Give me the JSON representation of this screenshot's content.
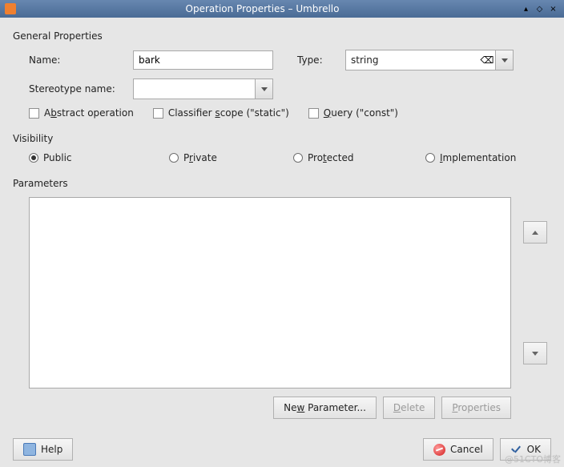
{
  "window": {
    "title": "Operation Properties – Umbrello",
    "shade_icon": "▴",
    "max_icon": "◇",
    "close_icon": "×"
  },
  "general": {
    "section": "General Properties",
    "name_label": "Name:",
    "name_value": "bark",
    "type_label": "Type:",
    "type_value": "string",
    "stereo_label": "Stereotype name:",
    "stereo_value": "",
    "abstract": {
      "pre": "A",
      "u": "b",
      "post": "stract operation"
    },
    "classifier": {
      "pre": "Classifier ",
      "u": "s",
      "post": "cope (\"static\")"
    },
    "query": {
      "u": "Q",
      "post": "uery (\"const\")"
    }
  },
  "visibility": {
    "section": "Visibility",
    "public": "Public",
    "private": {
      "pre": "P",
      "u": "r",
      "post": "ivate"
    },
    "protected": {
      "pre": "Pro",
      "u": "t",
      "post": "ected"
    },
    "implementation": {
      "u": "I",
      "post": "mplementation"
    }
  },
  "parameters": {
    "section": "Parameters",
    "new_btn": {
      "pre": "Ne",
      "u": "w",
      "post": " Parameter..."
    },
    "delete_btn": {
      "u": "D",
      "post": "elete"
    },
    "props_btn": {
      "u": "P",
      "post": "roperties"
    }
  },
  "bottom": {
    "help": "Help",
    "cancel": "Cancel",
    "ok": "OK"
  },
  "watermark": "@51CTO博客"
}
